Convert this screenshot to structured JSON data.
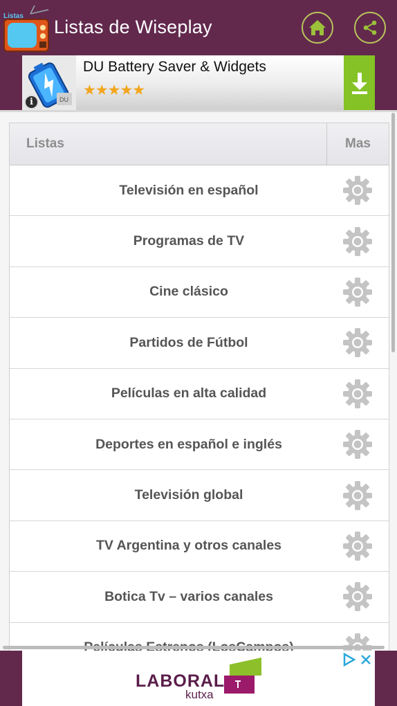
{
  "appbar": {
    "title": "Listas de Wiseplay",
    "logo_text": "Listas"
  },
  "ad_top": {
    "title": "DU Battery Saver & Widgets",
    "stars": "★★★★★",
    "rating": 4.5,
    "info_label": "i"
  },
  "table": {
    "header_lists": "Listas",
    "header_more": "Mas",
    "rows": [
      {
        "label": "Televisión en español"
      },
      {
        "label": "Programas de TV"
      },
      {
        "label": "Cine clásico"
      },
      {
        "label": "Partidos de Fútbol"
      },
      {
        "label": "Películas en alta calidad"
      },
      {
        "label": "Deportes en español e inglés"
      },
      {
        "label": "Televisión global"
      },
      {
        "label": "TV Argentina y otros canales"
      },
      {
        "label": "Botica Tv – varios canales"
      },
      {
        "label": "Películas Estrenos (LosCampos)"
      }
    ]
  },
  "ad_bottom": {
    "brand": "LABORAL",
    "sub": "kutxa"
  },
  "colors": {
    "appbar": "#62294d",
    "accent_ring": "#b7c25a",
    "download_green": "#84c225",
    "row_text": "#555555"
  }
}
